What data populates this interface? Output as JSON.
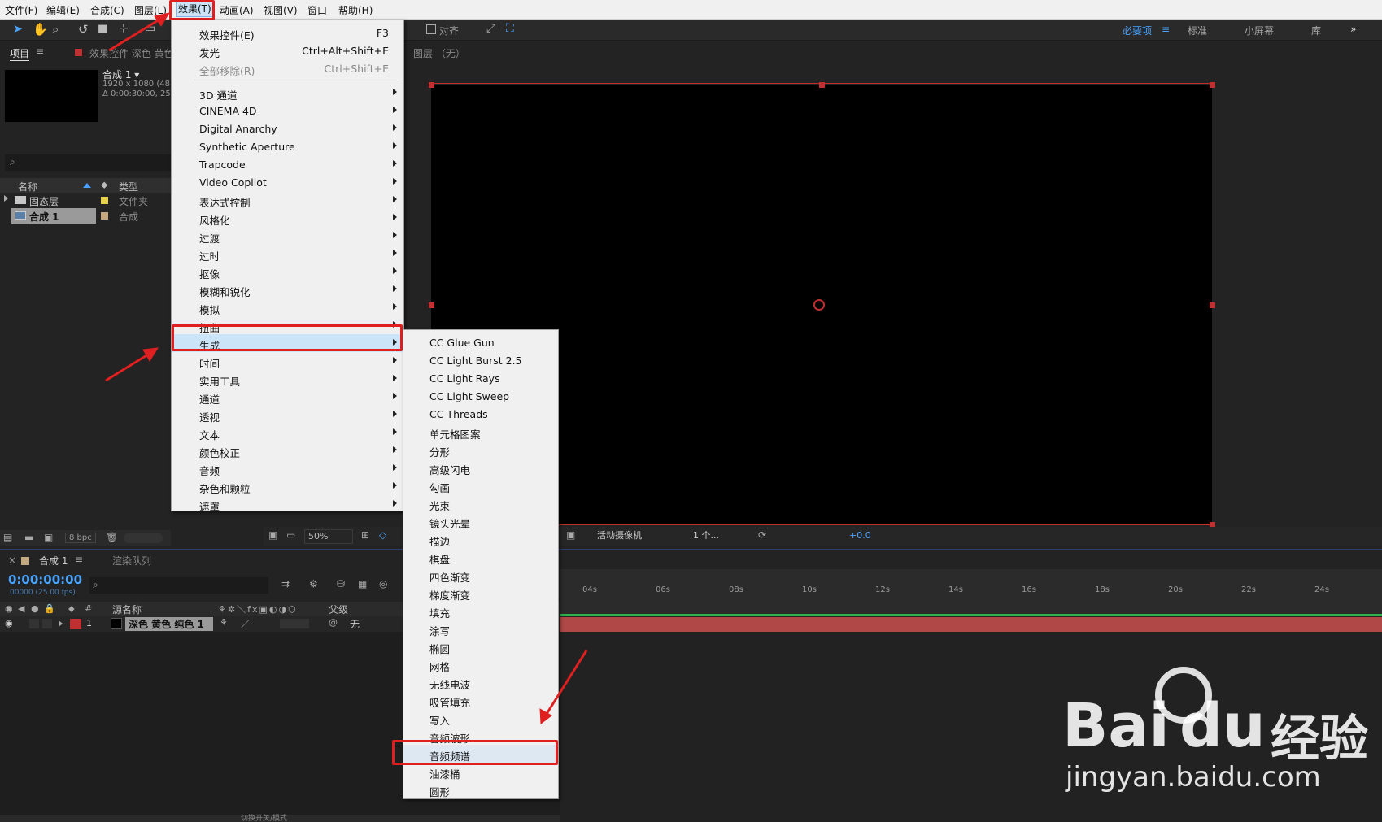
{
  "menubar": {
    "items": [
      "文件(F)",
      "编辑(E)",
      "合成(C)",
      "图层(L)",
      "效果(T)",
      "动画(A)",
      "视图(V)",
      "窗口",
      "帮助(H)"
    ]
  },
  "toolbar": {
    "snap_label": "对齐",
    "workspaces": [
      "必要项",
      "标准",
      "小屏幕",
      "库"
    ]
  },
  "project_panel": {
    "tab": "项目",
    "effects_tab": "效果控件 深色 黄色",
    "comp_name": "合成 1 ▾",
    "comp_size": "1920 x 1080 (48",
    "comp_duration": "Δ 0:00:30:00, 25",
    "col_name": "名称",
    "col_type": "类型",
    "rows": [
      {
        "name": "固态层",
        "type": "文件夹"
      },
      {
        "name": "合成 1",
        "type": "合成"
      }
    ],
    "bpc": "8 bpc"
  },
  "viewer": {
    "layer_label": "图层 （无）",
    "zoom": "50%",
    "camera": "活动摄像机",
    "views": "1 个...",
    "exposure": "+0.0"
  },
  "timeline": {
    "tab": "合成 1",
    "render_tab": "渲染队列",
    "timecode": "0:00:00:00",
    "fps": "00000 (25.00 fps)",
    "col_source": "源名称",
    "col_parent": "父级",
    "layer_num": "1",
    "layer_name": "深色 黄色 纯色 1",
    "parent_value": "无",
    "ruler": [
      "04s",
      "06s",
      "08s",
      "10s",
      "12s",
      "14s",
      "16s",
      "18s",
      "20s",
      "22s",
      "24s"
    ],
    "bottom_label": "切换开关/模式"
  },
  "effect_menu": {
    "top": [
      {
        "label": "效果控件(E)",
        "shortcut": "F3"
      },
      {
        "label": "发光",
        "shortcut": "Ctrl+Alt+Shift+E"
      },
      {
        "label": "全部移除(R)",
        "shortcut": "Ctrl+Shift+E"
      }
    ],
    "categories": [
      "3D 通道",
      "CINEMA 4D",
      "Digital Anarchy",
      "Synthetic Aperture",
      "Trapcode",
      "Video Copilot",
      "表达式控制",
      "风格化",
      "过渡",
      "过时",
      "抠像",
      "模糊和锐化",
      "模拟",
      "扭曲",
      "生成",
      "时间",
      "实用工具",
      "通道",
      "透视",
      "文本",
      "颜色校正",
      "音频",
      "杂色和颗粒",
      "遮罩"
    ]
  },
  "generate_submenu": {
    "items": [
      "CC Glue Gun",
      "CC Light Burst 2.5",
      "CC Light Rays",
      "CC Light Sweep",
      "CC Threads",
      "单元格图案",
      "分形",
      "高级闪电",
      "勾画",
      "光束",
      "镜头光晕",
      "描边",
      "棋盘",
      "四色渐变",
      "梯度渐变",
      "填充",
      "涂写",
      "椭圆",
      "网格",
      "无线电波",
      "吸管填充",
      "写入",
      "音频波形",
      "音频频谱",
      "油漆桶",
      "圆形"
    ]
  },
  "watermark": {
    "brand": "Bai",
    "brand2": "du",
    "cn": "经验",
    "url": "jingyan.baidu.com"
  },
  "colors": {
    "accent": "#2d8ceb",
    "highlight_red": "#e02020",
    "layer_bar": "#b04848"
  }
}
